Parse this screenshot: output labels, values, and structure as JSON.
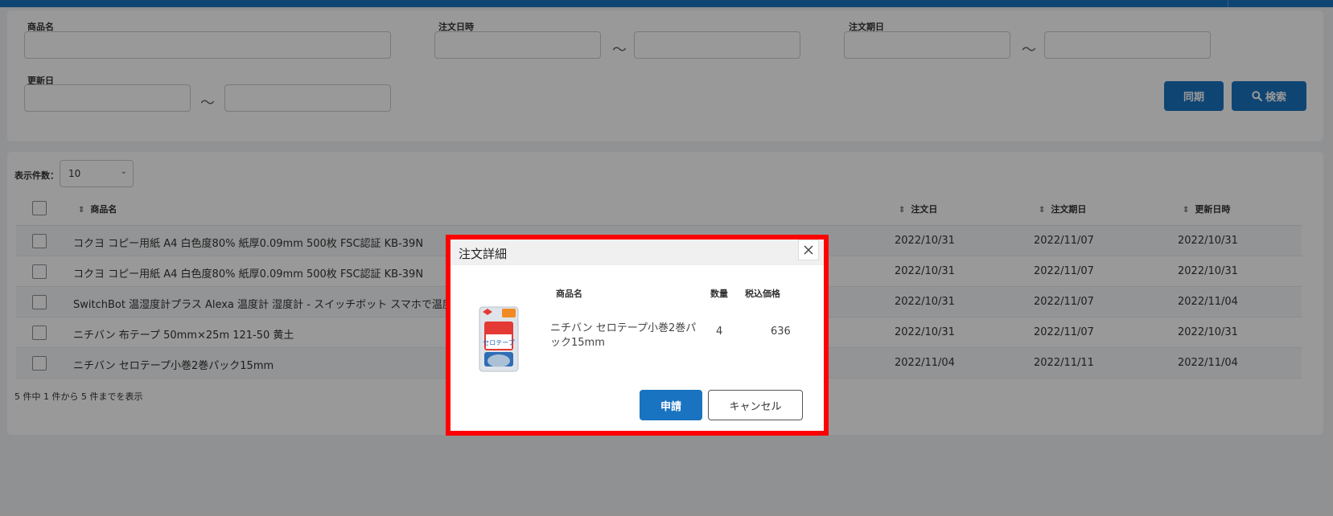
{
  "search": {
    "product_name_label": "商品名",
    "order_date_label": "注文日時",
    "due_date_label": "注文期日",
    "updated_label": "更新日",
    "range_sep": "〜",
    "sync_label": "同期",
    "search_label": "検索"
  },
  "list": {
    "count_label": "表示件数：",
    "count_value": "10",
    "headers": {
      "name": "商品名",
      "order_date": "注文日",
      "due_date": "注文期日",
      "updated_at": "更新日時"
    },
    "rows": [
      {
        "name": "コクヨ コピー用紙 A4 白色度80% 紙厚0.09mm 500枚 FSC認証 KB-39N",
        "order_date": "2022/10/31",
        "due_date": "2022/11/07",
        "updated_at": "2022/10/31"
      },
      {
        "name": "コクヨ コピー用紙 A4 白色度80% 紙厚0.09mm 500枚 FSC認証 KB-39N",
        "order_date": "2022/10/31",
        "due_date": "2022/11/07",
        "updated_at": "2022/10/31"
      },
      {
        "name": "SwitchBot 温湿度計プラス Alexa 温度計 湿度計 - スイッチボット スマホで温度湿",
        "order_date": "2022/10/31",
        "due_date": "2022/11/07",
        "updated_at": "2022/11/04"
      },
      {
        "name": "ニチバン 布テープ 50mm×25m 121-50 黄土",
        "order_date": "2022/10/31",
        "due_date": "2022/11/07",
        "updated_at": "2022/10/31"
      },
      {
        "name": "ニチバン セロテープ小巻2巻パック15mm",
        "order_date": "2022/11/04",
        "due_date": "2022/11/11",
        "updated_at": "2022/11/04"
      }
    ],
    "footer": "5 件中 1 件から 5 件までを表示"
  },
  "modal": {
    "title": "注文詳細",
    "headers": {
      "name": "商品名",
      "qty": "数量",
      "price": "税込価格"
    },
    "item": {
      "name_line1": "ニチバン セロテープ小巻2巻パ",
      "name_line2": "ック15mm",
      "qty": "4",
      "price": "636",
      "package_text": "セロテープ"
    },
    "apply_label": "申請",
    "cancel_label": "キャンセル"
  },
  "colors": {
    "primary": "#1a73c0",
    "highlight_border": "#ff0000"
  }
}
